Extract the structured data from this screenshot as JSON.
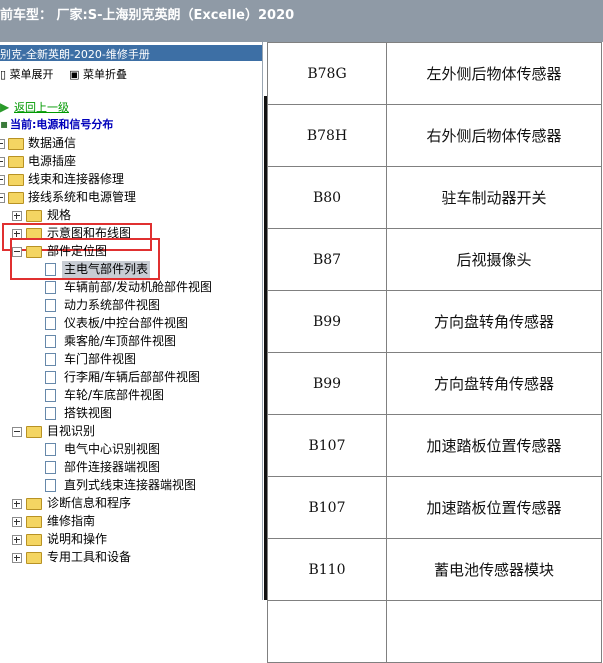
{
  "titlebar": {
    "text": "前车型：  厂家:S-上海别克英朗（Excelle）2020"
  },
  "left_panel": {
    "header": "别克-全新英朗-2020-维修手册",
    "toolbar": {
      "expand": "菜单展开",
      "collapse": "菜单折叠"
    },
    "back_link": "返回上一级",
    "current": "当前:电源和信号分布",
    "tree": {
      "data_comm": "数据通信",
      "power_socket": "电源插座",
      "harness_repair": "线束和连接器修理",
      "wiring_power": "接线系统和电源管理",
      "spec": "规格",
      "schematic": "示意图和布线图",
      "component_location": "部件定位图",
      "main_parts_list": "主电气部件列表",
      "front_engine_view": "车辆前部/发动机舱部件视图",
      "powertrain_view": "动力系统部件视图",
      "dash_console_view": "仪表板/中控台部件视图",
      "cabin_roof_view": "乘客舱/车顶部件视图",
      "door_view": "车门部件视图",
      "trunk_rear_view": "行李厢/车辆后部部件视图",
      "wheel_underbody_view": "车轮/车底部件视图",
      "ground_view": "搭铁视图",
      "visual_id": "目视识别",
      "electrical_center_id": "电气中心识别视图",
      "connector_end_view": "部件连接器端视图",
      "inline_connector_view": "直列式线束连接器端视图",
      "diagnostics": "诊断信息和程序",
      "repair_guide": "维修指南",
      "description_operation": "说明和操作",
      "special_tools": "专用工具和设备"
    }
  },
  "parts_table": {
    "rows": [
      {
        "code": "B78G",
        "name": "左外侧后物体传感器"
      },
      {
        "code": "B78H",
        "name": "右外侧后物体传感器"
      },
      {
        "code": "B80",
        "name": "驻车制动器开关"
      },
      {
        "code": "B87",
        "name": "后视摄像头"
      },
      {
        "code": "B99",
        "name": "方向盘转角传感器"
      },
      {
        "code": "B99",
        "name": "方向盘转角传感器"
      },
      {
        "code": "B107",
        "name": "加速踏板位置传感器"
      },
      {
        "code": "B107",
        "name": "加速踏板位置传感器"
      },
      {
        "code": "B110",
        "name": "蓄电池传感器模块"
      },
      {
        "code": "",
        "name": ""
      }
    ]
  },
  "colors": {
    "highlight": "#e03030",
    "header_bg": "#3d6fa5",
    "title_bg": "#8f9aa6"
  }
}
